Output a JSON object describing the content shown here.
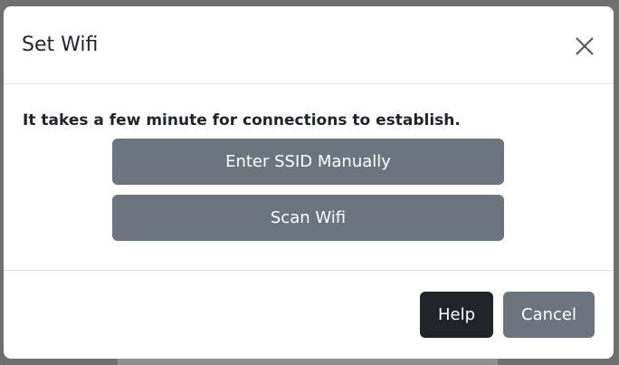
{
  "modal": {
    "title": "Set Wifi",
    "close_icon": "close-icon",
    "notice": "It takes a few minute for connections to establish.",
    "enter_ssid_label": "Enter SSID Manually",
    "scan_wifi_label": "Scan Wifi",
    "help_label": "Help",
    "cancel_label": "Cancel"
  },
  "colors": {
    "secondary_button": "#6c757d",
    "dark_button": "#212529",
    "backdrop": "#6f6f6f"
  }
}
